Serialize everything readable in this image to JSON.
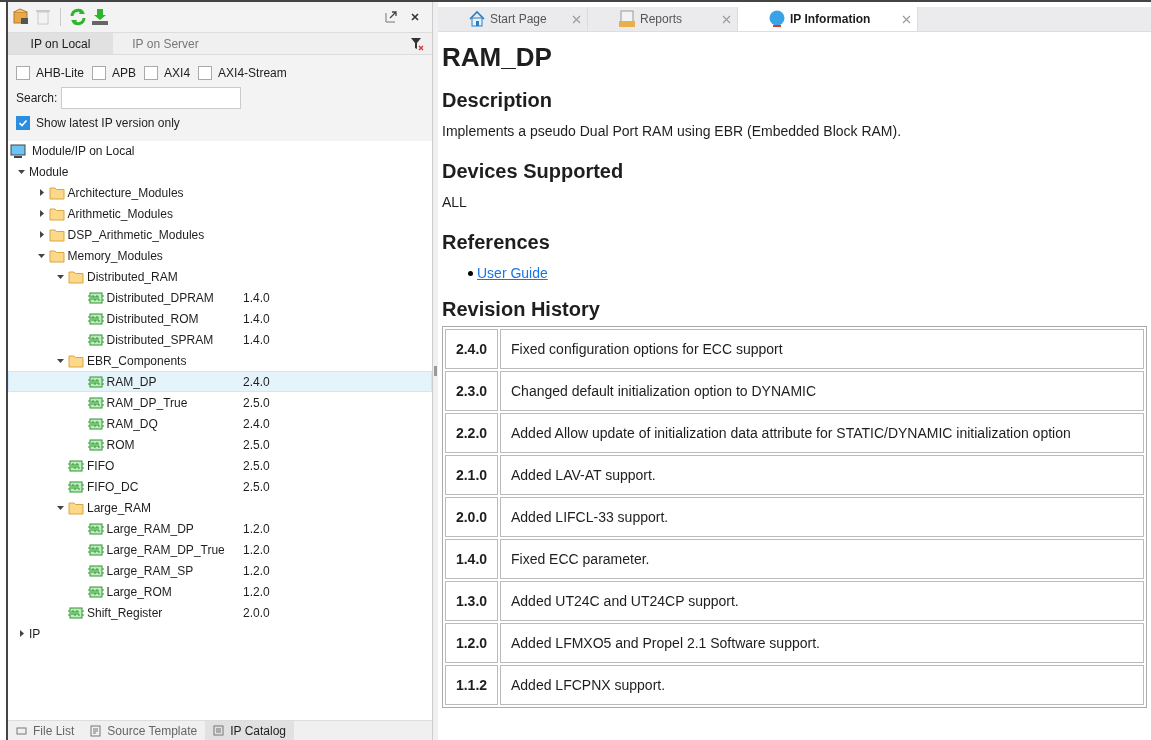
{
  "toolbar": {
    "buttons": [
      {
        "kind": "box",
        "disabled": false
      },
      {
        "kind": "trash",
        "disabled": true
      },
      {
        "kind": "refresh",
        "disabled": false
      },
      {
        "kind": "download",
        "disabled": false
      }
    ]
  },
  "panel_tabs": [
    {
      "label": "IP on Local",
      "selected": true
    },
    {
      "label": "IP on Server",
      "selected": false
    }
  ],
  "filters": [
    {
      "label": "AHB-Lite",
      "checked": false
    },
    {
      "label": "APB",
      "checked": false
    },
    {
      "label": "AXI4",
      "checked": false
    },
    {
      "label": "AXI4-Stream",
      "checked": false
    }
  ],
  "search": {
    "label": "Search:"
  },
  "latest_only": {
    "label": "Show latest IP version only",
    "checked": true
  },
  "tree": {
    "root": "Module/IP on Local",
    "children": [
      {
        "label": "Module",
        "expanded": true,
        "children": [
          {
            "label": "Architecture_Modules",
            "kind": "folder",
            "expanded": false
          },
          {
            "label": "Arithmetic_Modules",
            "kind": "folder",
            "expanded": false
          },
          {
            "label": "DSP_Arithmetic_Modules",
            "kind": "folder",
            "expanded": false
          },
          {
            "label": "Memory_Modules",
            "kind": "folder",
            "expanded": true,
            "children": [
              {
                "label": "Distributed_RAM",
                "kind": "folder",
                "expanded": true,
                "children": [
                  {
                    "label": "Distributed_DPRAM",
                    "kind": "ip",
                    "version": "1.4.0",
                    "selected": false
                  },
                  {
                    "label": "Distributed_ROM",
                    "kind": "ip",
                    "version": "1.4.0",
                    "selected": false
                  },
                  {
                    "label": "Distributed_SPRAM",
                    "kind": "ip",
                    "version": "1.4.0",
                    "selected": false
                  }
                ]
              },
              {
                "label": "EBR_Components",
                "kind": "folder",
                "expanded": true,
                "children": [
                  {
                    "label": "RAM_DP",
                    "kind": "ip",
                    "version": "2.4.0",
                    "selected": true
                  },
                  {
                    "label": "RAM_DP_True",
                    "kind": "ip",
                    "version": "2.5.0",
                    "selected": false
                  },
                  {
                    "label": "RAM_DQ",
                    "kind": "ip",
                    "version": "2.4.0",
                    "selected": false
                  },
                  {
                    "label": "ROM",
                    "kind": "ip",
                    "version": "2.5.0",
                    "selected": false
                  }
                ]
              },
              {
                "label": "FIFO",
                "kind": "ip",
                "version": "2.5.0",
                "selected": false
              },
              {
                "label": "FIFO_DC",
                "kind": "ip",
                "version": "2.5.0",
                "selected": false
              },
              {
                "label": "Large_RAM",
                "kind": "folder",
                "expanded": true,
                "children": [
                  {
                    "label": "Large_RAM_DP",
                    "kind": "ip",
                    "version": "1.2.0",
                    "selected": false
                  },
                  {
                    "label": "Large_RAM_DP_True",
                    "kind": "ip",
                    "version": "1.2.0",
                    "selected": false
                  },
                  {
                    "label": "Large_RAM_SP",
                    "kind": "ip",
                    "version": "1.2.0",
                    "selected": false
                  },
                  {
                    "label": "Large_ROM",
                    "kind": "ip",
                    "version": "1.2.0",
                    "selected": false
                  }
                ]
              },
              {
                "label": "Shift_Register",
                "kind": "ip",
                "version": "2.0.0",
                "selected": false
              }
            ]
          }
        ]
      },
      {
        "label": "IP",
        "expanded": false
      }
    ]
  },
  "bottom_tabs": [
    {
      "label": "File List",
      "kind": "folder",
      "selected": false
    },
    {
      "label": "Source Template",
      "kind": "template",
      "selected": false
    },
    {
      "label": "IP Catalog",
      "kind": "catalog",
      "selected": true
    }
  ],
  "editor_tabs": [
    {
      "label": "Start Page",
      "kind": "home",
      "selected": false
    },
    {
      "label": "Reports",
      "kind": "reports",
      "selected": false
    },
    {
      "label": "IP Information",
      "kind": "ip",
      "selected": true
    }
  ],
  "document": {
    "title": "RAM_DP",
    "sections": [
      {
        "heading": "Description",
        "kind": "text",
        "text": "Implements a pseudo Dual Port RAM using EBR (Embedded Block RAM)."
      },
      {
        "heading": "Devices Supported",
        "kind": "text",
        "text": "ALL"
      },
      {
        "heading": "References",
        "kind": "links",
        "links": [
          "User Guide"
        ]
      },
      {
        "heading": "Revision History",
        "kind": "table",
        "rows": [
          [
            "2.4.0",
            "Fixed configuration options for ECC support"
          ],
          [
            "2.3.0",
            "Changed default initialization option to DYNAMIC"
          ],
          [
            "2.2.0",
            "Added Allow update of initialization data attribute for STATIC/DYNAMIC initialization option"
          ],
          [
            "2.1.0",
            "Added LAV-AT support."
          ],
          [
            "2.0.0",
            "Added LIFCL-33 support."
          ],
          [
            "1.4.0",
            "Fixed ECC parameter."
          ],
          [
            "1.3.0",
            "Added UT24C and UT24CP support."
          ],
          [
            "1.2.0",
            "Added LFMXO5 and Propel 2.1 Software support."
          ],
          [
            "1.1.2",
            "Added LFCPNX support."
          ]
        ]
      }
    ]
  }
}
